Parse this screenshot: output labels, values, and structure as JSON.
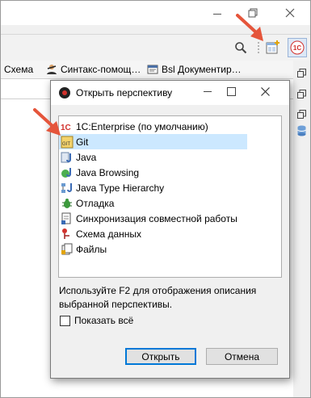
{
  "ide": {
    "tabs": [
      {
        "label": "Схема",
        "icon": "schema-icon"
      },
      {
        "label": "Синтакс-помощ…",
        "icon": "syntax-helper-icon"
      },
      {
        "label": "Bsl Документир…",
        "icon": "bsl-doc-icon"
      }
    ],
    "toolbar_badge": "1C"
  },
  "dialog": {
    "title": "Открыть перспективу",
    "items": [
      {
        "label": "1C:Enterprise (по умолчанию)",
        "icon": "1c-enterprise-icon"
      },
      {
        "label": "Git",
        "icon": "git-icon",
        "selected": true
      },
      {
        "label": "Java",
        "icon": "java-icon"
      },
      {
        "label": "Java Browsing",
        "icon": "java-browsing-icon"
      },
      {
        "label": "Java Type Hierarchy",
        "icon": "java-hierarchy-icon"
      },
      {
        "label": "Отладка",
        "icon": "debug-icon"
      },
      {
        "label": "Синхронизация совместной работы",
        "icon": "sync-icon"
      },
      {
        "label": "Схема данных",
        "icon": "data-schema-icon"
      },
      {
        "label": "Файлы",
        "icon": "files-icon"
      }
    ],
    "hint": "Используйте F2 для отображения описания выбранной перспективы.",
    "show_all": "Показать всё",
    "ok": "Открыть",
    "cancel": "Отмена"
  },
  "colors": {
    "accent": "#0078d7",
    "selection": "#cce8ff",
    "arrow": "#e5553b"
  }
}
